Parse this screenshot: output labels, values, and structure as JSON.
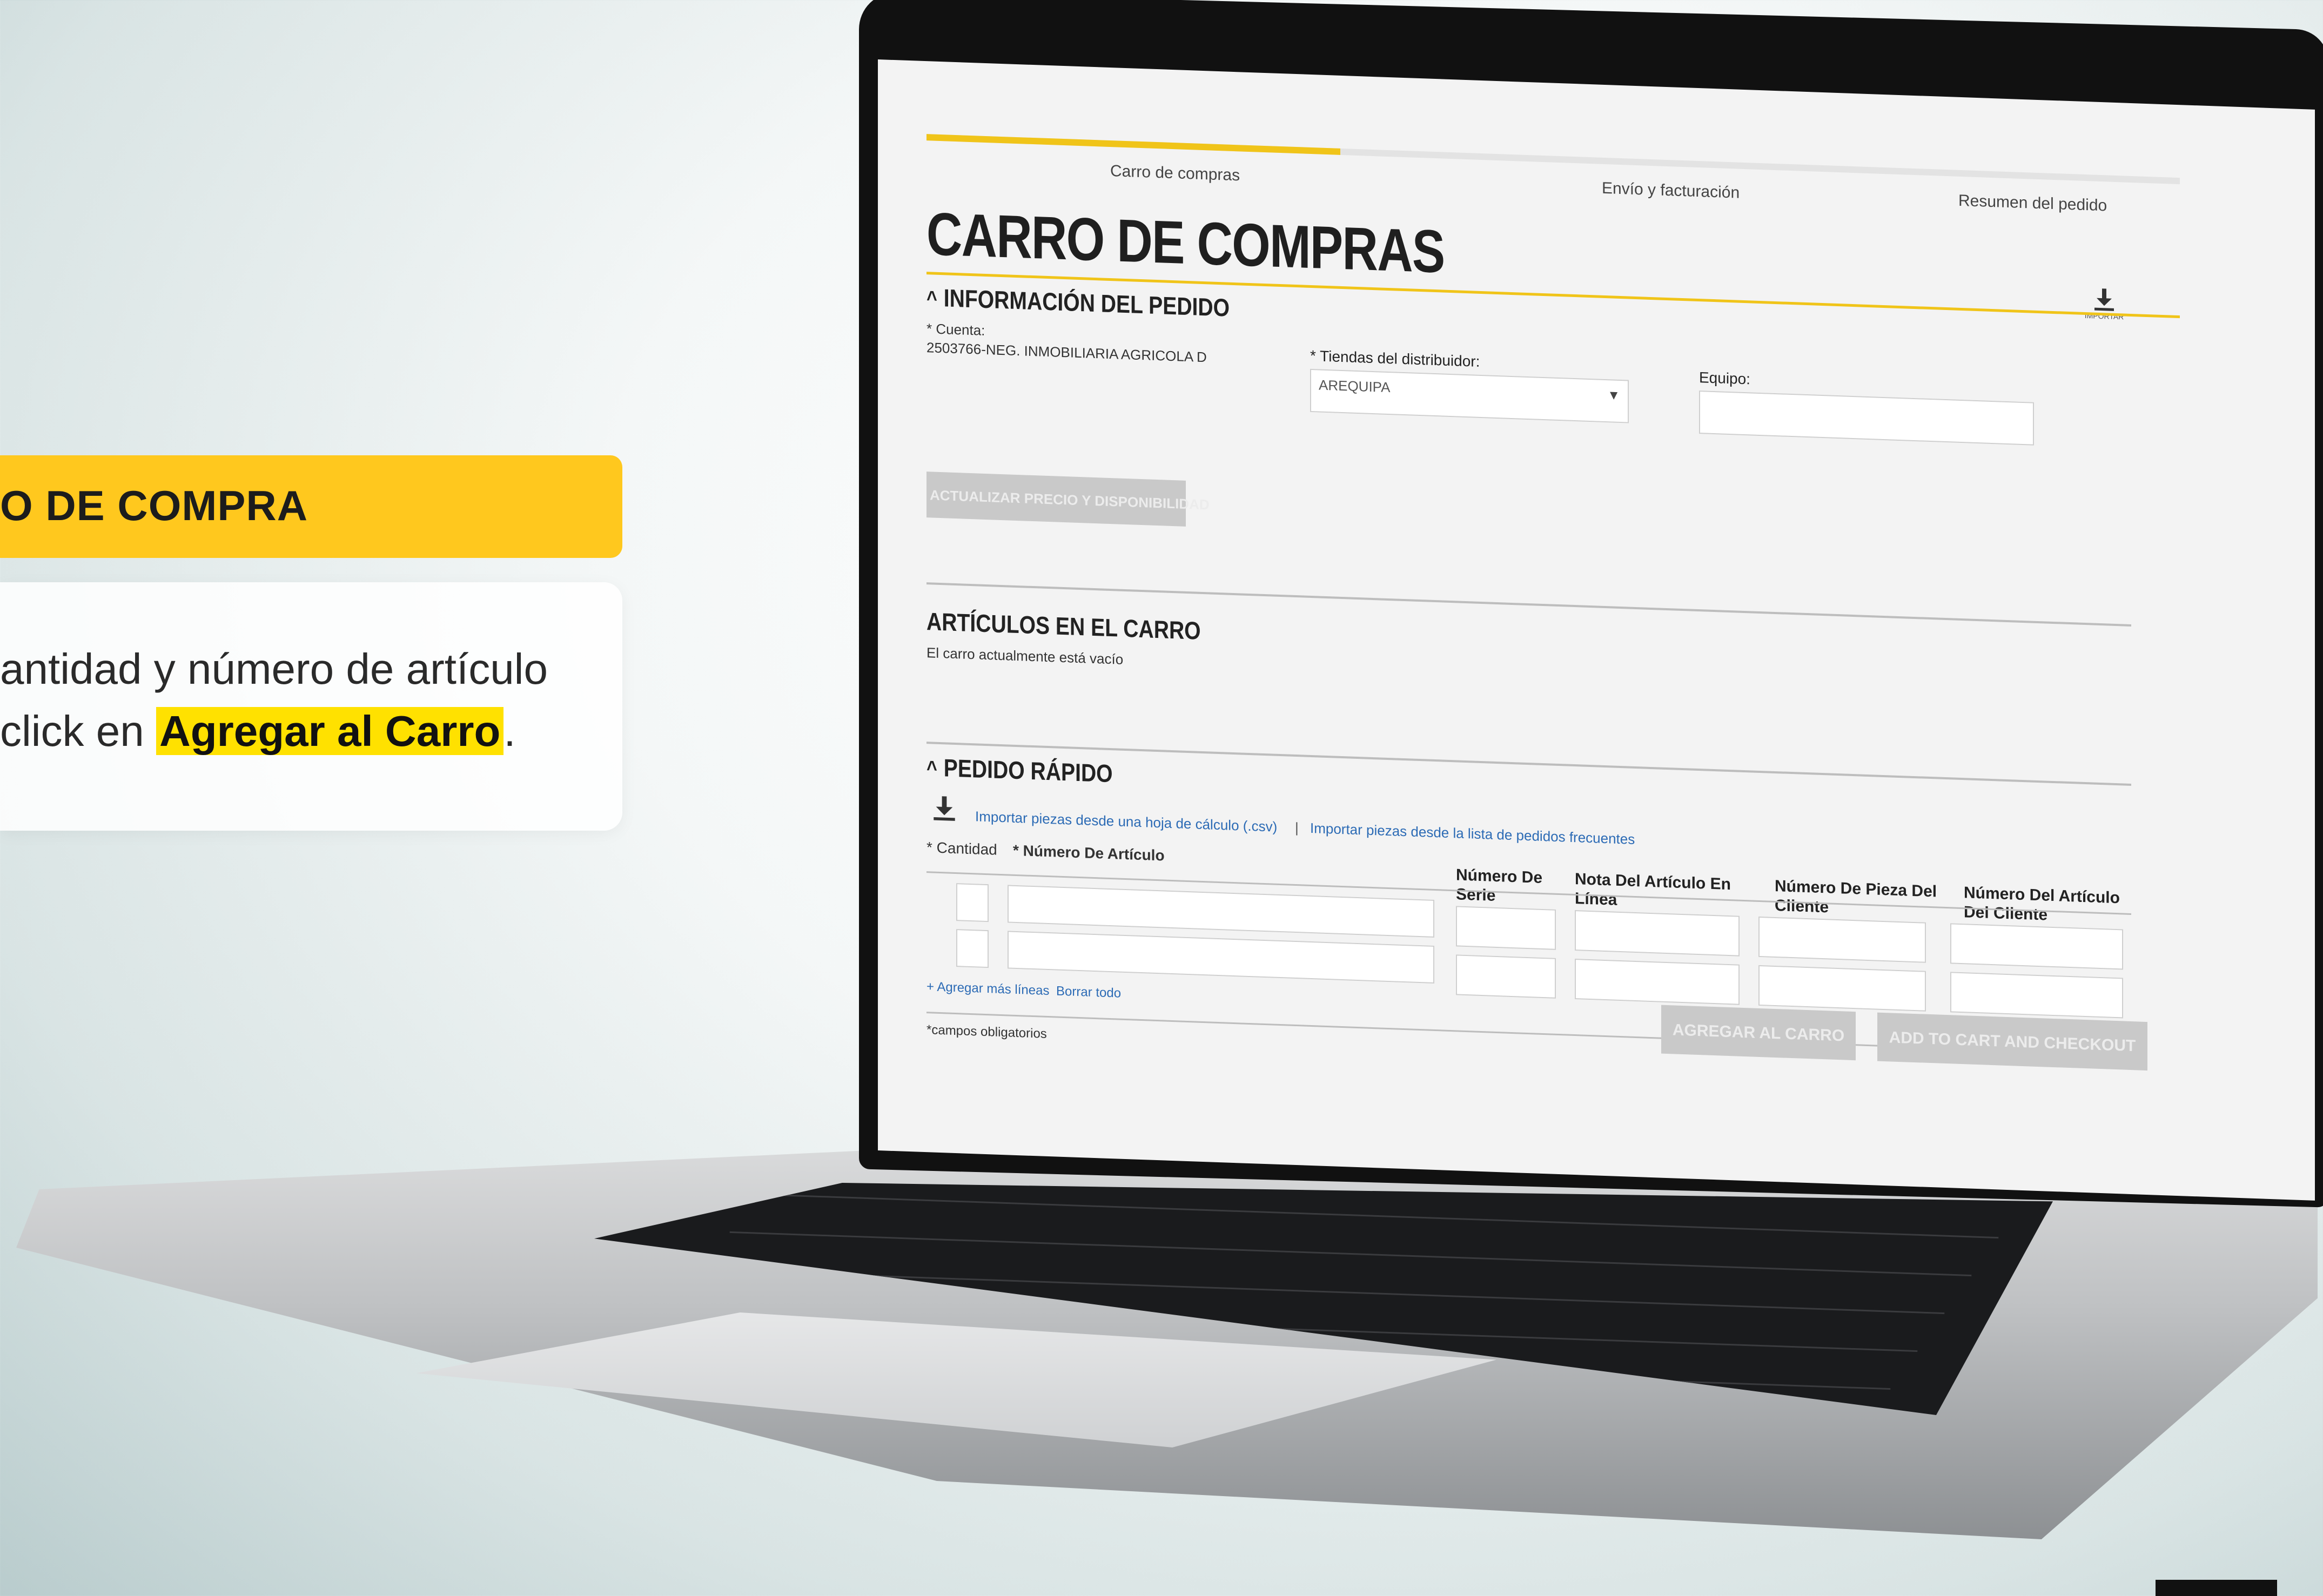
{
  "instructions": {
    "step_title": "O DE COMPRA",
    "line1": "antidad y número de artículo",
    "line2_prefix": " click en",
    "line2_highlight": "Agregar al Carro",
    "line2_suffix": "."
  },
  "checkout": {
    "steps": [
      "Carro de compras",
      "Envío y facturación",
      "Resumen del pedido"
    ],
    "progress_fraction": 0.33,
    "page_title": "CARRO DE COMPRAS",
    "export_label": "IMPORTAR",
    "order_info": {
      "section_title": "INFORMACIÓN DEL PEDIDO",
      "account_label": "* Cuenta:",
      "account_value": "2503766-NEG. INMOBILIARIA AGRICOLA D",
      "stores_label": "* Tiendas del distribuidor:",
      "stores_value": "AREQUIPA",
      "team_label": "Equipo:",
      "update_button": "ACTUALIZAR PRECIO Y DISPONIBILIDAD"
    },
    "cart_items": {
      "section_title": "ARTÍCULOS EN EL CARRO",
      "empty_text": "El carro actualmente está vacío"
    },
    "quick_order": {
      "section_title": "PEDIDO RÁPIDO",
      "import_csv_link": "Importar piezas desde una hoja de cálculo (.csv)",
      "separator": "|",
      "import_frequent_link": "Importar piezas desde la lista de pedidos frecuentes",
      "quantity_label": "* Cantidad",
      "item_number_label": "* Número De Artículo",
      "serial_label": "Número De Serie",
      "line_note_label": "Nota Del Artículo En Línea",
      "customer_part_label": "Número De Pieza Del Cliente",
      "customer_item_label": "Número Del Artículo Del Cliente",
      "add_lines_link": "+ Agregar más líneas",
      "clear_all_link": "Borrar todo",
      "required_note": "*campos obligatorios",
      "add_to_cart_button": "AGREGAR AL CARRO",
      "checkout_button": "ADD TO CART AND CHECKOUT"
    }
  }
}
